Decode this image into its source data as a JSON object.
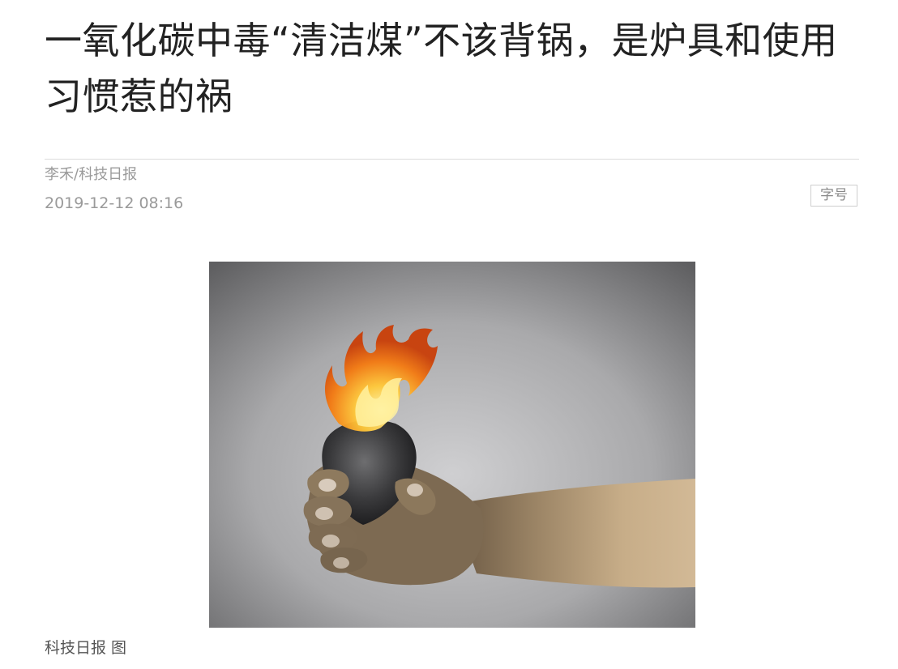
{
  "article": {
    "title": "一氧化碳中毒“清洁煤”不该背锅，是炉具和使用习惯惹的祸",
    "byline": "李禾/科技日报",
    "date": "2019-12-12 08:16",
    "font_size_label": "字号"
  },
  "figure": {
    "subject": "hand-holding-burning-coal",
    "caption": "科技日报 图"
  }
}
